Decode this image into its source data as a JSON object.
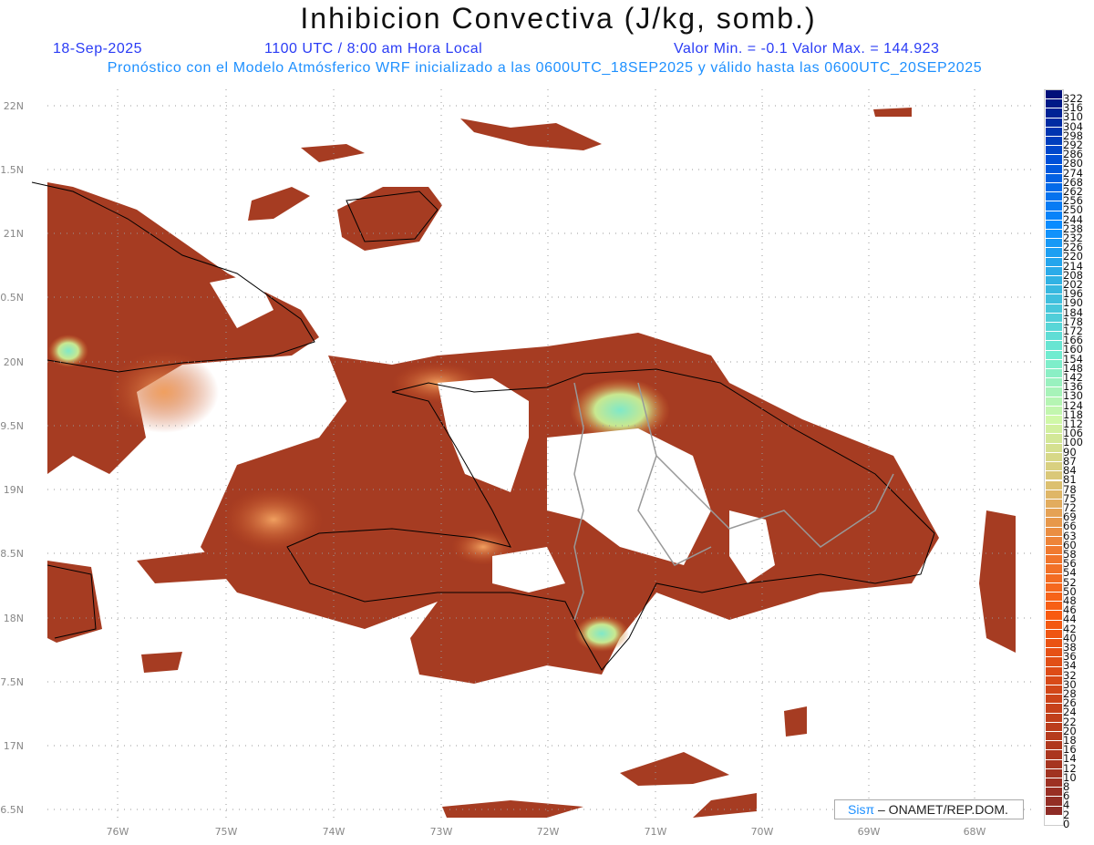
{
  "header": {
    "title": "Inhibicion Convectiva (J/kg, somb.)",
    "date": "18-Sep-2025",
    "time": "1100 UTC / 8:00 am Hora Local",
    "minmax": "Valor Min. = -0.1  Valor Max. = 144.923",
    "subtitle": "Pronóstico con el Modelo Atmósferico WRF inicializado a las 0600UTC_18SEP2025 y válido hasta las  0600UTC_20SEP2025"
  },
  "axes": {
    "lon_labels": [
      "76W",
      "75W",
      "74W",
      "73W",
      "72W",
      "71W",
      "70W",
      "69W",
      "68W"
    ],
    "lat_labels": [
      "22N",
      "1.5N",
      "21N",
      "0.5N",
      "20N",
      "9.5N",
      "19N",
      "8.5N",
      "18N",
      "7.5N",
      "17N",
      "6.5N"
    ]
  },
  "colorbar": {
    "labels": [
      "322",
      "316",
      "310",
      "304",
      "298",
      "292",
      "286",
      "280",
      "274",
      "268",
      "262",
      "256",
      "250",
      "244",
      "238",
      "232",
      "226",
      "220",
      "214",
      "208",
      "202",
      "196",
      "190",
      "184",
      "178",
      "172",
      "166",
      "160",
      "154",
      "148",
      "142",
      "136",
      "130",
      "124",
      "118",
      "112",
      "106",
      "100",
      "90",
      "87",
      "84",
      "81",
      "78",
      "75",
      "72",
      "69",
      "66",
      "63",
      "60",
      "58",
      "56",
      "54",
      "52",
      "50",
      "48",
      "46",
      "44",
      "42",
      "40",
      "38",
      "36",
      "34",
      "32",
      "30",
      "28",
      "26",
      "24",
      "22",
      "20",
      "18",
      "16",
      "14",
      "12",
      "10",
      "8",
      "6",
      "4",
      "2",
      "0"
    ],
    "anchor_colors": [
      "#00107a",
      "#0050d8",
      "#0a8cff",
      "#38b8e0",
      "#70ecd0",
      "#d0f8a8",
      "#dcc070",
      "#f07a30",
      "#f85a10",
      "#d84a18",
      "#b0381e",
      "#8e2c26",
      "#ffffff"
    ]
  },
  "credit": {
    "brand": "Sisπ",
    "text": " – ONAMET/REP.DOM."
  }
}
